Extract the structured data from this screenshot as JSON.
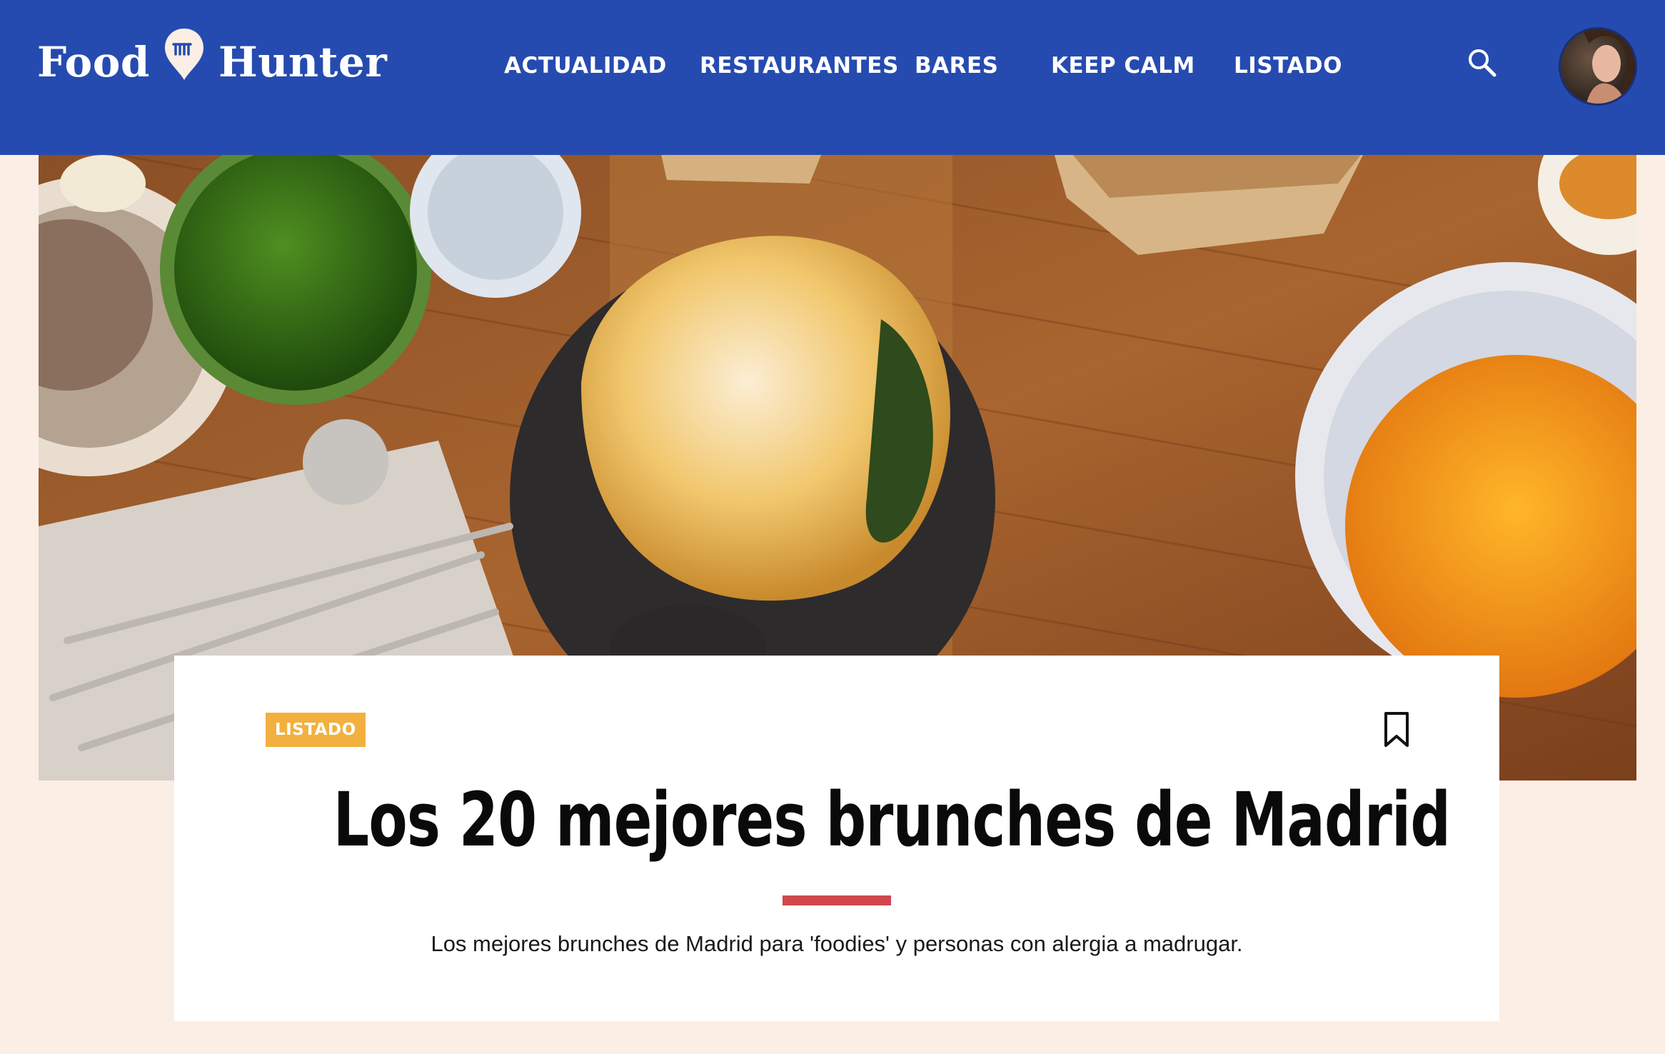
{
  "header": {
    "brand_word_1": "Food",
    "brand_word_2": "Hunter",
    "nav": [
      {
        "label": "ACTUALIDAD"
      },
      {
        "label": "RESTAURANTES"
      },
      {
        "label": "BARES"
      },
      {
        "label": "KEEP CALM"
      },
      {
        "label": "LISTADO"
      }
    ],
    "search_icon": "search-icon",
    "avatar": "user-avatar"
  },
  "colors": {
    "header_bg": "#264bb0",
    "page_bg": "#fbeee5",
    "badge_bg": "#f2b13f",
    "divider": "#d0474e"
  },
  "article": {
    "category": "LISTADO",
    "title": "Los 20 mejores brunches de Madrid",
    "subtitle": "Los mejores brunches de Madrid para 'foodies' y personas con alergia a madrugar.",
    "bookmark_icon": "bookmark-icon"
  }
}
